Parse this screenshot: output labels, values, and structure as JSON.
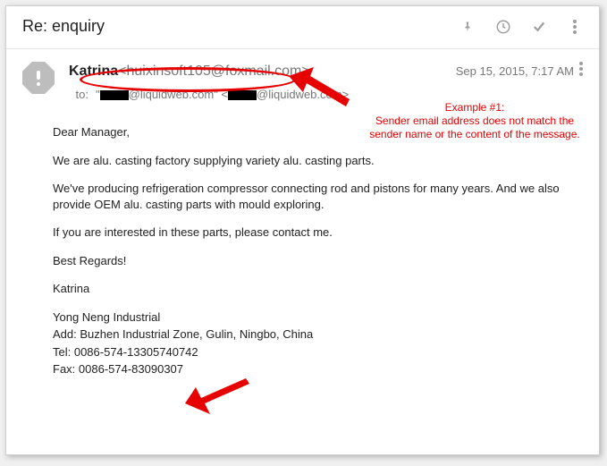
{
  "header": {
    "subject": "Re: enquiry"
  },
  "icons": {
    "pin": "pin-icon",
    "clock": "clock-icon",
    "check": "check-icon",
    "more": "more-icon",
    "warn": "warn-icon"
  },
  "sender": {
    "name": "Katrina",
    "email": "<huixinsoft105@foxmail.com>",
    "timestamp": "Sep 15, 2015, 7:17 AM"
  },
  "to": {
    "label": "to:",
    "display_addr_local": "\"",
    "display_addr_domain1": "@liquidweb.com\" <",
    "display_addr_domain2": "@liquidweb.com>"
  },
  "body": {
    "greeting": "Dear Manager,",
    "p1": "We are alu. casting factory supplying variety alu. casting parts.",
    "p2": "We've producing refrigeration compressor connecting rod and pistons for many years. And we also provide OEM alu. casting parts with mould exploring.",
    "p3": "If you are interested in these parts, please contact me.",
    "signoff": "Best Regards!",
    "sig_name": "Katrina",
    "company": "Yong Neng Industrial",
    "addr": "Add: Buzhen Industrial Zone, Gulin, Ningbo, China",
    "tel": "Tel: 0086-574-13305740742",
    "fax": "Fax: 0086-574-83090307"
  },
  "annotation": {
    "title": "Example #1:",
    "text": "Sender email address does not match the sender name or the content of the message."
  }
}
